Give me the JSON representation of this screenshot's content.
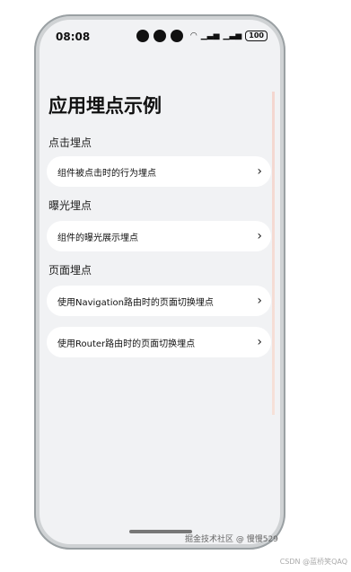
{
  "status_bar": {
    "time": "08:08",
    "battery": "100"
  },
  "page": {
    "title": "应用埋点示例"
  },
  "sections": [
    {
      "label": "点击埋点",
      "items": [
        {
          "label": "组件被点击时的行为埋点"
        }
      ]
    },
    {
      "label": "曝光埋点",
      "items": [
        {
          "label": "组件的曝光展示埋点"
        }
      ]
    },
    {
      "label": "页面埋点",
      "items": [
        {
          "label": "使用Navigation路由时的页面切换埋点"
        },
        {
          "label": "使用Router路由时的页面切换埋点"
        }
      ]
    }
  ],
  "watermarks": {
    "inner": "掘金技术社区 @ 慢慢529",
    "outer": "CSDN @蓝桥笑QAQ"
  },
  "icons": {
    "chevron": "chevron-right-icon"
  },
  "colors": {
    "screen_bg": "#f1f2f4",
    "card_bg": "#ffffff"
  }
}
